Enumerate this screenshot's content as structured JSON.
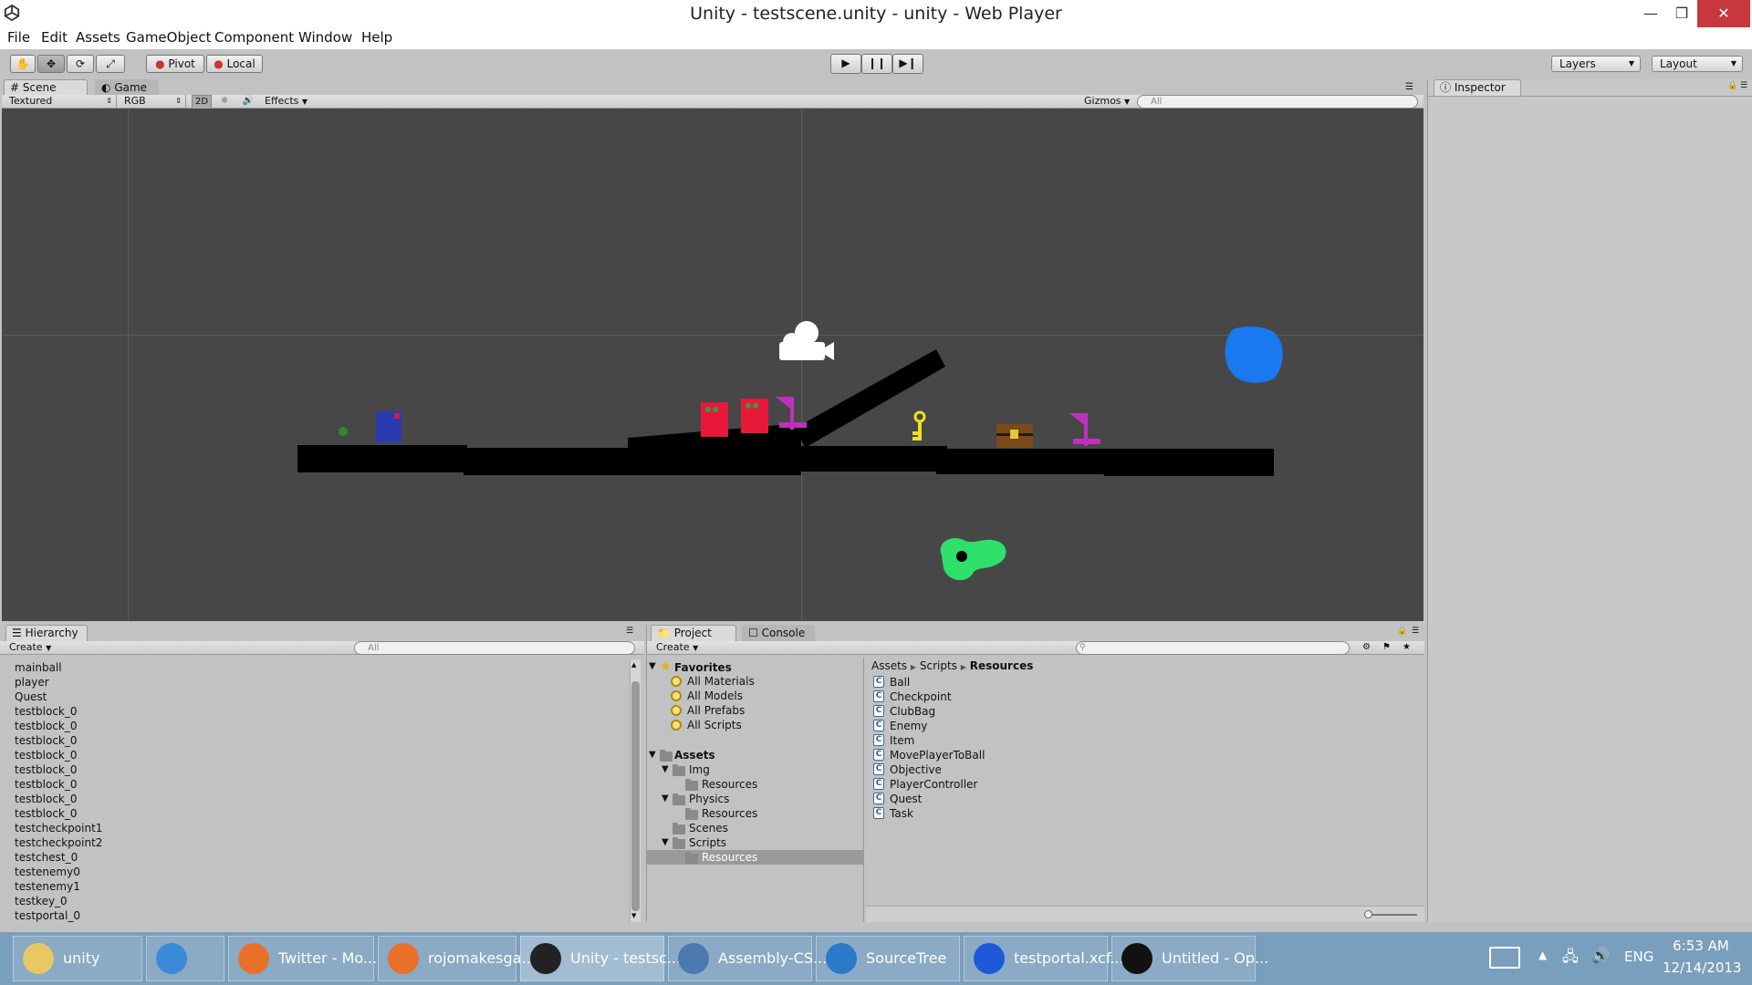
{
  "window": {
    "title": "Unity - testscene.unity - unity - Web Player",
    "minimize_icon": "minimize-icon",
    "maximize_icon": "restore-icon",
    "close_icon": "close-icon"
  },
  "menu": [
    "File",
    "Edit",
    "Assets",
    "GameObject",
    "Component",
    "Window",
    "Help"
  ],
  "toolbar": {
    "pivot": "Pivot",
    "local": "Local",
    "layers": "Layers",
    "layout": "Layout"
  },
  "scene_tabs": {
    "scene": "Scene",
    "game": "Game"
  },
  "scene_bar": {
    "render_mode": "Textured",
    "color_mode": "RGB",
    "toggle_2d": "2D",
    "effects": "Effects",
    "gizmos": "Gizmos",
    "search_placeholder": "All"
  },
  "inspector": {
    "tab": "Inspector"
  },
  "hierarchy": {
    "tab": "Hierarchy",
    "create": "Create",
    "search_placeholder": "All",
    "items": [
      "mainball",
      "player",
      "Quest",
      "testblock_0",
      "testblock_0",
      "testblock_0",
      "testblock_0",
      "testblock_0",
      "testblock_0",
      "testblock_0",
      "testblock_0",
      "testcheckpoint1",
      "testcheckpoint2",
      "testchest_0",
      "testenemy0",
      "testenemy1",
      "testkey_0",
      "testportal_0"
    ]
  },
  "project": {
    "tab": "Project",
    "console_tab": "Console",
    "create": "Create",
    "favorites_label": "Favorites",
    "favorites": [
      "All Materials",
      "All Models",
      "All Prefabs",
      "All Scripts"
    ],
    "assets_label": "Assets",
    "tree": [
      {
        "label": "Img",
        "indent": 1
      },
      {
        "label": "Resources",
        "indent": 2
      },
      {
        "label": "Physics",
        "indent": 1
      },
      {
        "label": "Resources",
        "indent": 2
      },
      {
        "label": "Scenes",
        "indent": 1
      },
      {
        "label": "Scripts",
        "indent": 1
      },
      {
        "label": "Resources",
        "indent": 2
      }
    ],
    "breadcrumb": [
      "Assets",
      "Scripts",
      "Resources"
    ],
    "files": [
      "Ball",
      "Checkpoint",
      "ClubBag",
      "Enemy",
      "Item",
      "MovePlayerToBall",
      "Objective",
      "PlayerController",
      "Quest",
      "Task"
    ]
  },
  "taskbar": {
    "items": [
      {
        "label": "unity",
        "icon": "folder-icon",
        "color": "#e8c860"
      },
      {
        "label": "",
        "icon": "internet-explorer-icon",
        "color": "#3a8ad8"
      },
      {
        "label": "Twitter - Mo...",
        "icon": "firefox-icon",
        "color": "#e8702a"
      },
      {
        "label": "rojomakesga...",
        "icon": "firefox-icon",
        "color": "#e8702a"
      },
      {
        "label": "Unity - testsc...",
        "icon": "unity-icon",
        "color": "#222222"
      },
      {
        "label": "Assembly-CS...",
        "icon": "monodevelop-icon",
        "color": "#4a7ab0"
      },
      {
        "label": "SourceTree",
        "icon": "sourcetree-icon",
        "color": "#2a7ac8"
      },
      {
        "label": "testportal.xcf...",
        "icon": "gimp-icon",
        "color": "#1e5ad8"
      },
      {
        "label": "Untitled - Op...",
        "icon": "obs-icon",
        "color": "#111111"
      }
    ],
    "language": "ENG",
    "time": "6:53 AM",
    "date": "12/14/2013"
  }
}
